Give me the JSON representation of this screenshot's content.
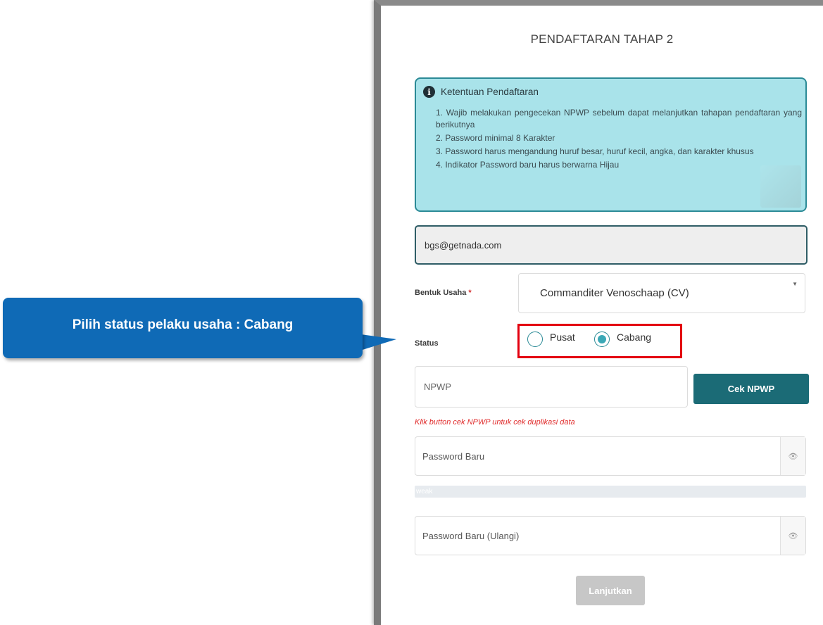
{
  "callout": {
    "text": "Pilih status pelaku usaha : Cabang"
  },
  "form": {
    "title": "PENDAFTARAN TAHAP 2",
    "info": {
      "icon": "info-icon",
      "title": "Ketentuan Pendaftaran",
      "items": [
        "1. Wajib melakukan pengecekan NPWP sebelum dapat melanjutkan tahapan pendaftaran yang berikutnya",
        "2. Password minimal 8 Karakter",
        "3. Password harus mengandung huruf besar, huruf kecil, angka, dan karakter khusus",
        "4. Indikator Password baru harus berwarna Hijau"
      ]
    },
    "email": {
      "value": "bgs@getnada.com"
    },
    "bentuk_usaha": {
      "label": "Bentuk Usaha",
      "required_mark": "*",
      "selected": "Commanditer Venoschaap (CV)"
    },
    "status": {
      "label": "Status",
      "options": [
        {
          "label": "Pusat",
          "checked": false
        },
        {
          "label": "Cabang",
          "checked": true
        }
      ]
    },
    "npwp": {
      "placeholder": "NPWP",
      "button": "Cek NPWP",
      "hint": "Klik button cek NPWP untuk cek duplikasi data"
    },
    "password": {
      "placeholder": "Password Baru",
      "strength": "weak"
    },
    "password_repeat": {
      "placeholder": "Password Baru (Ulangi)"
    },
    "submit": {
      "label": "Lanjutkan"
    }
  },
  "colors": {
    "accent": "#1b6b76",
    "callout": "#0f6ab6",
    "highlight": "#e3000f",
    "info_bg": "#a9e3ea"
  }
}
